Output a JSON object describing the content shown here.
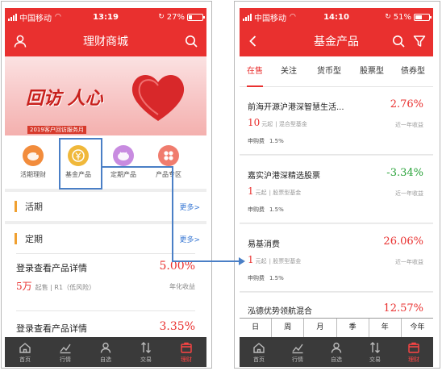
{
  "left": {
    "status": {
      "carrier": "中国移动",
      "time": "13:19",
      "battery": "27%",
      "battery_level": 0.27
    },
    "nav_title": "理财商城",
    "banner": {
      "headline": "回访 人心",
      "footer": "2019客户回访服务月"
    },
    "tiles": [
      {
        "label": "活期理财",
        "color": "#f28c3c",
        "icon": "piggy-bank-icon"
      },
      {
        "label": "基金产品",
        "color": "#f0b83a",
        "icon": "fund-coin-icon"
      },
      {
        "label": "定期产品",
        "color": "#c88be0",
        "icon": "pig-icon"
      },
      {
        "label": "产品专区",
        "color": "#f07c6e",
        "icon": "grid-icon"
      }
    ],
    "sections": [
      {
        "name": "活期",
        "more": "更多>"
      },
      {
        "name": "定期",
        "more": "更多>"
      }
    ],
    "products": [
      {
        "name": "登录查看产品详情",
        "rate": "5.00%",
        "amount": "5万",
        "amount_note": "起售 | R1（低风险）",
        "rate_label": "年化收益"
      },
      {
        "name": "登录查看产品详情",
        "rate": "3.35%"
      }
    ],
    "tabbar": [
      {
        "label": "首页",
        "icon": "home-icon",
        "active": false
      },
      {
        "label": "行情",
        "icon": "chart-icon",
        "active": false
      },
      {
        "label": "自选",
        "icon": "user-icon",
        "active": false
      },
      {
        "label": "交易",
        "icon": "trade-icon",
        "active": false
      },
      {
        "label": "理财",
        "icon": "finance-icon",
        "active": true
      }
    ]
  },
  "right": {
    "status": {
      "carrier": "中国移动",
      "time": "14:10",
      "battery": "51%",
      "battery_level": 0.51
    },
    "nav_title": "基金产品",
    "tabs": [
      "在售",
      "关注",
      "货币型",
      "股票型",
      "债券型"
    ],
    "active_tab": 0,
    "funds": [
      {
        "name": "前海开源沪港深智慧生活...",
        "pct": "2.76%",
        "trend": "up",
        "min": "10",
        "unit": "元起",
        "type": "| 混合型基金",
        "period": "近一年收益",
        "fee_label": "申购费",
        "fee": "1.5%"
      },
      {
        "name": "嘉实沪港深精选股票",
        "pct": "-3.34%",
        "trend": "down",
        "min": "1",
        "unit": "元起",
        "type": "| 股票型基金",
        "period": "近一年收益",
        "fee_label": "申购费",
        "fee": "1.5%"
      },
      {
        "name": "易基消费",
        "pct": "26.06%",
        "trend": "up",
        "min": "1",
        "unit": "元起",
        "type": "| 股票型基金",
        "period": "近一年收益",
        "fee_label": "申购费",
        "fee": "1.5%"
      },
      {
        "name": "泓德优势领航混合",
        "pct": "12.57%",
        "trend": "up"
      }
    ],
    "periods": [
      "日",
      "周",
      "月",
      "季",
      "年",
      "今年"
    ],
    "tabbar": [
      {
        "label": "首页",
        "icon": "home-icon",
        "active": false
      },
      {
        "label": "行情",
        "icon": "chart-icon",
        "active": false
      },
      {
        "label": "自选",
        "icon": "user-icon",
        "active": false
      },
      {
        "label": "交易",
        "icon": "trade-icon",
        "active": false
      },
      {
        "label": "理财",
        "icon": "finance-icon",
        "active": true
      }
    ]
  },
  "colors": {
    "brand": "#e9302f",
    "up": "#e9302f",
    "down": "#2aa33a",
    "link": "#3a79d4",
    "highlight": "#4a7fc6",
    "tabbar": "#3a3a3a"
  }
}
